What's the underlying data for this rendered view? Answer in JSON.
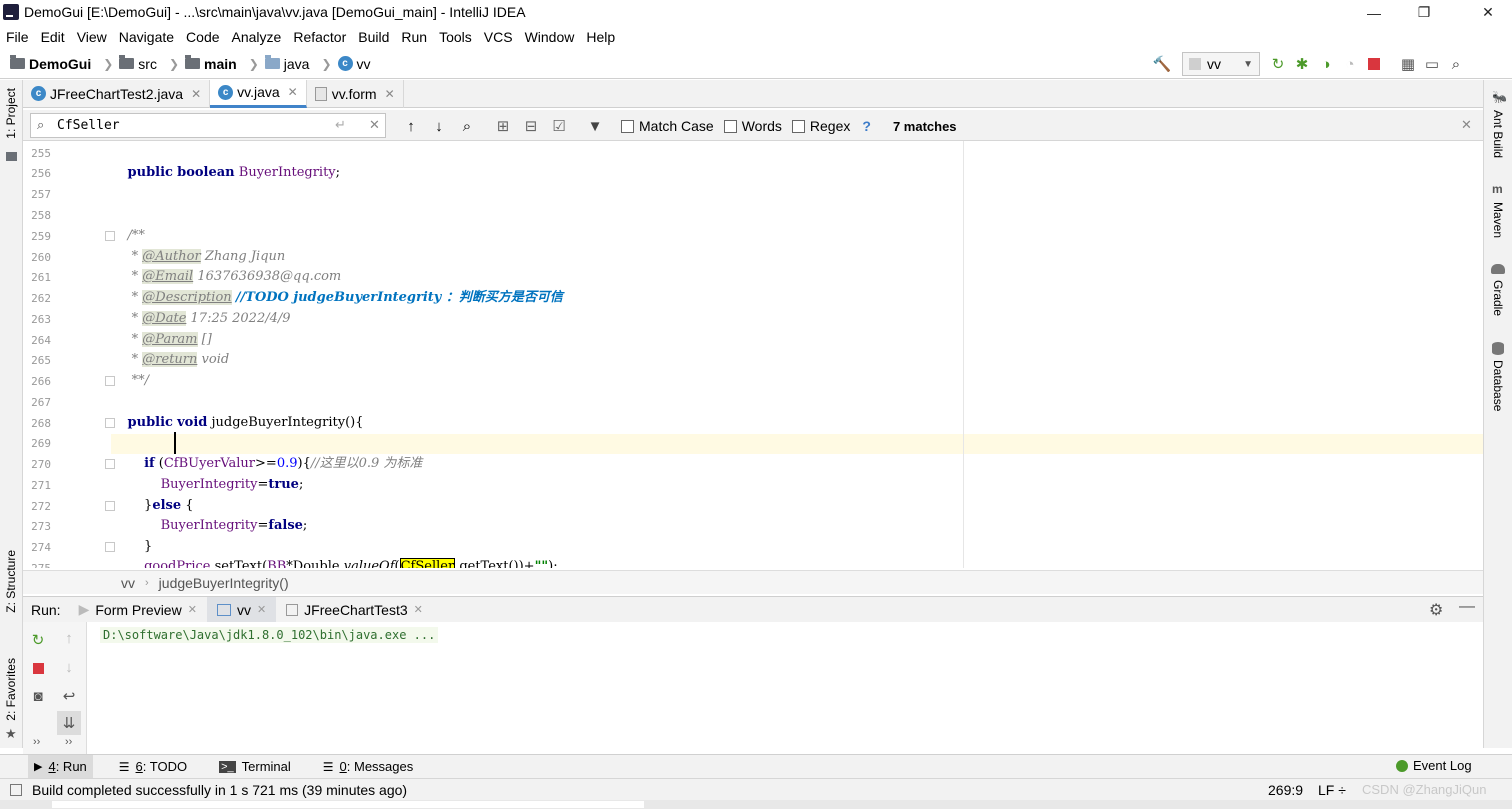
{
  "window": {
    "title": "DemoGui [E:\\DemoGui] - ...\\src\\main\\java\\vv.java [DemoGui_main] - IntelliJ IDEA",
    "minimize": "—",
    "restore": "❐",
    "close": "✕"
  },
  "menu": [
    "File",
    "Edit",
    "View",
    "Navigate",
    "Code",
    "Analyze",
    "Refactor",
    "Build",
    "Run",
    "Tools",
    "VCS",
    "Window",
    "Help"
  ],
  "navbar": {
    "crumbs": [
      "DemoGui",
      "src",
      "main",
      "java",
      "vv"
    ],
    "run_config": "vv"
  },
  "left_strip": {
    "project": "1: Project",
    "structure": "Z: Structure",
    "favorites": "2: Favorites"
  },
  "right_strip": {
    "ant": "Ant Build",
    "maven": "Maven",
    "gradle": "Gradle",
    "database": "Database"
  },
  "tabs": [
    {
      "label": "JFreeChartTest2.java"
    },
    {
      "label": "vv.java"
    },
    {
      "label": "vv.form"
    }
  ],
  "find": {
    "query": "CfSeller",
    "match_case": "Match Case",
    "words": "Words",
    "regex": "Regex",
    "help": "?",
    "matches": "7 matches"
  },
  "editor": {
    "line_numbers": [
      "255",
      "256",
      "257",
      "258",
      "259",
      "260",
      "261",
      "262",
      "263",
      "264",
      "265",
      "266",
      "267",
      "268",
      "269",
      "270",
      "271",
      "272",
      "273",
      "274",
      "275"
    ],
    "author_tag": "@Author",
    "author": "Zhang Jiqun",
    "email_tag": "@Email",
    "email": "1637636938@qq.com",
    "desc_tag": "@Description",
    "desc_todo": "//TODO judgeBuyerIntegrity ：判断买方是否可信",
    "date_tag": "@Date",
    "date": "17:25 2022/4/9",
    "param_tag": "@Param",
    "param": "[]",
    "return_tag": "@return",
    "return": "void",
    "comment_threshold": "//这里以0.9 为标准",
    "search_hit": "CfSeller"
  },
  "code_breadcrumb": {
    "cls": "vv",
    "method": "judgeBuyerIntegrity()"
  },
  "run_panel": {
    "label": "Run:",
    "tabs": [
      "Form Preview",
      "vv",
      "JFreeChartTest3"
    ],
    "console": "D:\\software\\Java\\jdk1.8.0_102\\bin\\java.exe ..."
  },
  "tool_windows": [
    {
      "key": "4",
      "label": ": Run"
    },
    {
      "key": "6",
      "label": ": TODO"
    },
    {
      "key": "",
      "label": "Terminal"
    },
    {
      "key": "0",
      "label": ": Messages"
    }
  ],
  "event_log": "Event Log",
  "status": {
    "message": "Build completed successfully in 1 s 721 ms (39 minutes ago)",
    "position": "269:9",
    "line_sep": "LF ÷",
    "watermark": "CSDN @ZhangJiQun"
  }
}
